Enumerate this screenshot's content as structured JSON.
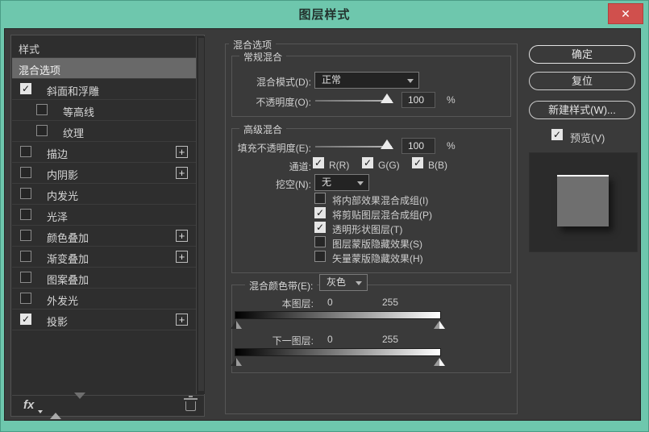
{
  "window": {
    "title": "图层样式",
    "close_glyph": "✕"
  },
  "colors": {
    "frame_teal": "#6ec7ad",
    "close_red": "#d0504d",
    "dialog_bg": "#3a3a3a",
    "sidebar_bg": "#2e2e2e",
    "selected_item_bg": "#696969",
    "text": "#d6d6d6"
  },
  "sidebar": {
    "items": [
      {
        "label": "样式",
        "type": "plain",
        "checked": null
      },
      {
        "label": "混合选项",
        "type": "selected",
        "checked": null
      },
      {
        "label": "斜面和浮雕",
        "type": "effect",
        "checked": true,
        "plus": false,
        "indent": false
      },
      {
        "label": "等高线",
        "type": "effect",
        "checked": false,
        "plus": false,
        "indent": true
      },
      {
        "label": "纹理",
        "type": "effect",
        "checked": false,
        "plus": false,
        "indent": true
      },
      {
        "label": "描边",
        "type": "effect",
        "checked": false,
        "plus": true,
        "indent": false
      },
      {
        "label": "内阴影",
        "type": "effect",
        "checked": false,
        "plus": true,
        "indent": false
      },
      {
        "label": "内发光",
        "type": "effect",
        "checked": false,
        "plus": false,
        "indent": false
      },
      {
        "label": "光泽",
        "type": "effect",
        "checked": false,
        "plus": false,
        "indent": false
      },
      {
        "label": "颜色叠加",
        "type": "effect",
        "checked": false,
        "plus": true,
        "indent": false
      },
      {
        "label": "渐变叠加",
        "type": "effect",
        "checked": false,
        "plus": true,
        "indent": false
      },
      {
        "label": "图案叠加",
        "type": "effect",
        "checked": false,
        "plus": false,
        "indent": false
      },
      {
        "label": "外发光",
        "type": "effect",
        "checked": false,
        "plus": false,
        "indent": false
      },
      {
        "label": "投影",
        "type": "effect",
        "checked": true,
        "plus": true,
        "indent": false
      }
    ],
    "toolbar": {
      "fx_label": "fx"
    }
  },
  "main": {
    "section_title": "混合选项",
    "general": {
      "legend": "常规混合",
      "blend_mode_label": "混合模式(D):",
      "blend_mode_value": "正常",
      "opacity_label": "不透明度(O):",
      "opacity_value": "100",
      "percent": "%"
    },
    "advanced": {
      "legend": "高级混合",
      "fill_opacity_label": "填充不透明度(E):",
      "fill_opacity_value": "100",
      "percent": "%",
      "channels_label": "通道:",
      "channels": [
        {
          "label": "R(R)",
          "checked": true
        },
        {
          "label": "G(G)",
          "checked": true
        },
        {
          "label": "B(B)",
          "checked": true
        }
      ],
      "knockout_label": "挖空(N):",
      "knockout_value": "无",
      "options": [
        {
          "label": "将内部效果混合成组(I)",
          "checked": false
        },
        {
          "label": "将剪贴图层混合成组(P)",
          "checked": true
        },
        {
          "label": "透明形状图层(T)",
          "checked": true
        },
        {
          "label": "图层蒙版隐藏效果(S)",
          "checked": false
        },
        {
          "label": "矢量蒙版隐藏效果(H)",
          "checked": false
        }
      ]
    },
    "blend_if": {
      "legend_label": "混合颜色带(E):",
      "mode_value": "灰色",
      "rows": [
        {
          "label": "本图层:",
          "min": "0",
          "max": "255"
        },
        {
          "label": "下一图层:",
          "min": "0",
          "max": "255"
        }
      ]
    }
  },
  "buttons": {
    "ok": "确定",
    "reset": "复位",
    "new_style": "新建样式(W)...",
    "preview_label": "预览(V)"
  }
}
